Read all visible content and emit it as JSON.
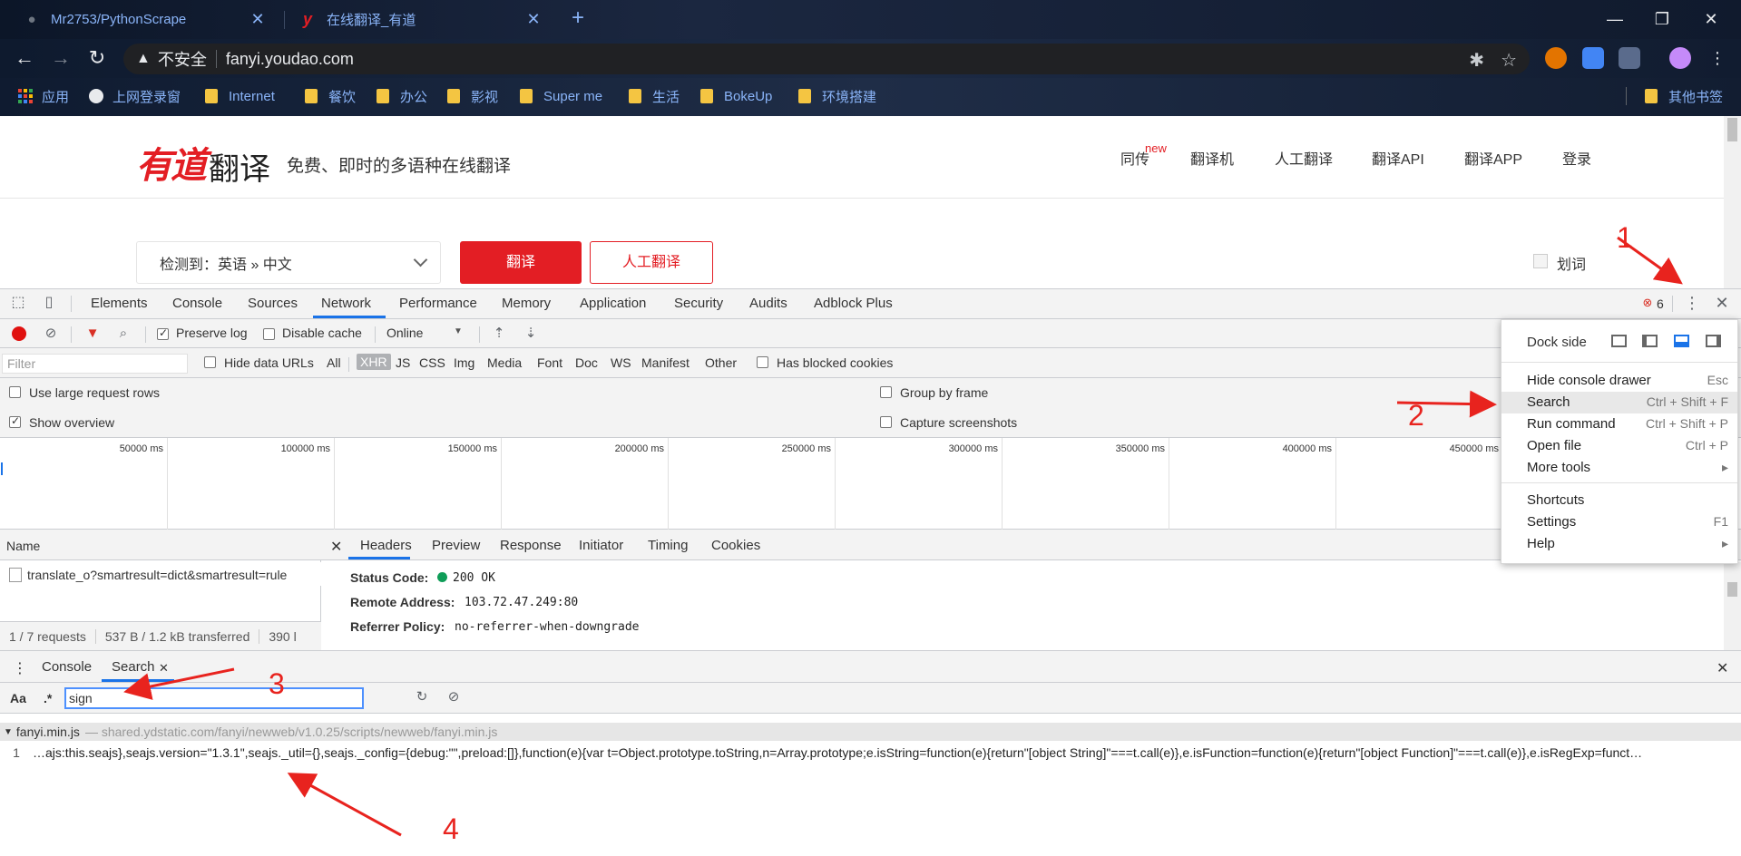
{
  "browser": {
    "tabs": [
      {
        "title": "Mr2753/PythonScrape",
        "favicon": "github-icon"
      },
      {
        "title": "在线翻译_有道",
        "favicon": "youdao-y-icon"
      }
    ],
    "address": {
      "security_text": "不安全",
      "url": "fanyi.youdao.com"
    },
    "bookmarks": [
      "应用",
      "上网登录窗",
      "Internet",
      "餐饮",
      "办公",
      "影视",
      "Super me",
      "生活",
      "BokeUp",
      "环境搭建"
    ],
    "other_bookmarks": "其他书签"
  },
  "page": {
    "logo_brand": "有道",
    "logo_product": "翻译",
    "slogan": "免费、即时的多语种在线翻译",
    "nav": [
      "同传",
      "翻译机",
      "人工翻译",
      "翻译API",
      "翻译APP",
      "登录"
    ],
    "new_badge": "new",
    "lang_select": "检测到：英语  »  中文",
    "translate_button": "翻译",
    "human_button": "人工翻译",
    "huaci_label": "划词"
  },
  "devtools": {
    "tabs": [
      "Elements",
      "Console",
      "Sources",
      "Network",
      "Performance",
      "Memory",
      "Application",
      "Security",
      "Audits",
      "Adblock Plus"
    ],
    "active_tab": "Network",
    "error_count": "6",
    "network_toolbar": {
      "preserve_log": "Preserve log",
      "disable_cache": "Disable cache",
      "throttle": "Online"
    },
    "filter": {
      "placeholder": "Filter",
      "hide_data_urls": "Hide data URLs",
      "types": [
        "All",
        "XHR",
        "JS",
        "CSS",
        "Img",
        "Media",
        "Font",
        "Doc",
        "WS",
        "Manifest",
        "Other"
      ],
      "active_type": "XHR",
      "has_blocked_cookies": "Has blocked cookies"
    },
    "settings": {
      "large_rows": "Use large request rows",
      "show_overview": "Show overview",
      "group_by_frame": "Group by frame",
      "capture_screenshots": "Capture screenshots"
    },
    "overview_ticks": [
      "50000 ms",
      "100000 ms",
      "150000 ms",
      "200000 ms",
      "250000 ms",
      "300000 ms",
      "350000 ms",
      "400000 ms",
      "450000 ms"
    ],
    "requests": {
      "name_header": "Name",
      "rows": [
        "translate_o?smartresult=dict&smartresult=rule"
      ],
      "status": [
        "1 / 7 requests",
        "537 B / 1.2 kB transferred",
        "390 l"
      ]
    },
    "detail_tabs": [
      "Headers",
      "Preview",
      "Response",
      "Initiator",
      "Timing",
      "Cookies"
    ],
    "headers": [
      {
        "key": "Status Code:",
        "value": "200 OK"
      },
      {
        "key": "Remote Address:",
        "value": "103.72.47.249:80"
      },
      {
        "key": "Referrer Policy:",
        "value": "no-referrer-when-downgrade"
      }
    ],
    "drawer": {
      "tabs": [
        "Console",
        "Search"
      ],
      "aa": "Aa",
      "regex": ".*",
      "query": "sign",
      "result_file": "fanyi.min.js",
      "result_path": "— shared.ydstatic.com/fanyi/newweb/v1.0.25/scripts/newweb/fanyi.min.js",
      "result_line_no": "1",
      "result_text": "…ajs:this.seajs},seajs.version=\"1.3.1\",seajs._util={},seajs._config={debug:\"\",preload:[]},function(e){var t=Object.prototype.toString,n=Array.prototype;e.isString=function(e){return\"[object String]\"===t.call(e)},e.isFunction=function(e){return\"[object Function]\"===t.call(e)},e.isRegExp=funct…"
    },
    "menu": {
      "dock_side": "Dock side",
      "items": [
        {
          "label": "Hide console drawer",
          "shortcut": "Esc"
        },
        {
          "label": "Search",
          "shortcut": "Ctrl + Shift + F"
        },
        {
          "label": "Run command",
          "shortcut": "Ctrl + Shift + P"
        },
        {
          "label": "Open file",
          "shortcut": "Ctrl + P"
        },
        {
          "label": "More tools",
          "shortcut": "▸"
        },
        {
          "label": "Shortcuts",
          "shortcut": ""
        },
        {
          "label": "Settings",
          "shortcut": "F1"
        },
        {
          "label": "Help",
          "shortcut": "▸"
        }
      ]
    }
  },
  "annotations": [
    "1",
    "2",
    "3",
    "4"
  ],
  "colors": {
    "accent": "#e31e24",
    "devtools_blue": "#1a73e8",
    "annotation_red": "#e8231e"
  }
}
